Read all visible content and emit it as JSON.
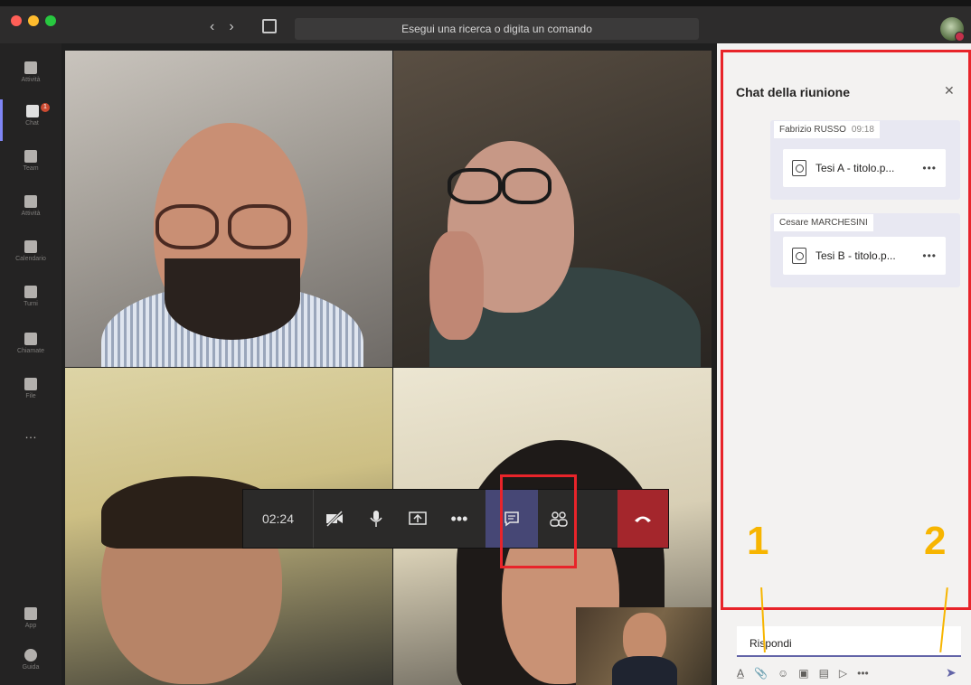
{
  "window": {
    "search_placeholder": "Esegui una ricerca o digita un comando",
    "traffic_lights": [
      "#ff5f57",
      "#febc2e",
      "#28c840"
    ]
  },
  "rail": {
    "items": [
      {
        "label": "Attività",
        "icon": "bell-icon"
      },
      {
        "label": "Chat",
        "icon": "chat-icon",
        "badge": "1"
      },
      {
        "label": "Team",
        "icon": "teams-icon"
      },
      {
        "label": "Attività",
        "icon": "assignments-icon"
      },
      {
        "label": "Calendario",
        "icon": "calendar-icon"
      },
      {
        "label": "Turni",
        "icon": "shifts-icon"
      },
      {
        "label": "Chiamate",
        "icon": "phone-icon"
      },
      {
        "label": "File",
        "icon": "file-icon"
      },
      {
        "label": "…",
        "icon": "more-icon"
      }
    ],
    "apps_label": "App",
    "help_label": "Guida"
  },
  "call": {
    "timer": "02:24"
  },
  "chat": {
    "title": "Chat della riunione",
    "messages": [
      {
        "author": "Fabrizio RUSSO",
        "time": "09:18",
        "file": "Tesi A - titolo.p..."
      },
      {
        "author": "Cesare MARCHESINI",
        "time": "",
        "file": "Tesi B - titolo.p..."
      }
    ],
    "reply_placeholder": "Rispondi"
  },
  "annotations": {
    "label_1": "1",
    "label_2": "2",
    "highlight_color": "#e8242a",
    "marker_color": "#f7b500"
  }
}
